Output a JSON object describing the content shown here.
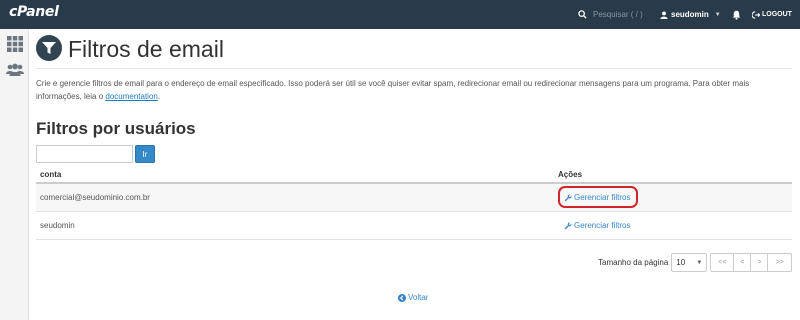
{
  "topbar": {
    "logo": "cPanel",
    "search_placeholder": "Pesquisar ( / )",
    "username": "seudomin",
    "logout_label": "LOGOUT"
  },
  "page": {
    "title": "Filtros de email",
    "description": "Crie e gerencie filtros de email para o endereço de email especificado. Isso poderá ser útil se você quiser evitar spam, redirecionar email ou redirecionar mensagens para um programa. Para obter mais informações, leia o ",
    "doc_link": "documentation",
    "desc_end": "."
  },
  "users_section": {
    "title": "Filtros por usuários",
    "search_value": "",
    "go_label": "Ir",
    "columns": [
      "conta",
      "Ações"
    ],
    "rows": [
      {
        "account": "comercial@seudominio.com.br",
        "action": "Gerenciar filtros"
      },
      {
        "account": "seudomin",
        "action": "Gerenciar filtros"
      }
    ]
  },
  "pagination": {
    "page_size_label": "Tamanho da página",
    "page_size": "10",
    "first": "<<",
    "prev": "<",
    "next": ">",
    "last": ">>"
  },
  "back_label": "Voltar",
  "colors": {
    "topbar": "#293a4a",
    "link": "#3a87c8",
    "highlight": "#d0252a",
    "button": "#3589c8"
  }
}
